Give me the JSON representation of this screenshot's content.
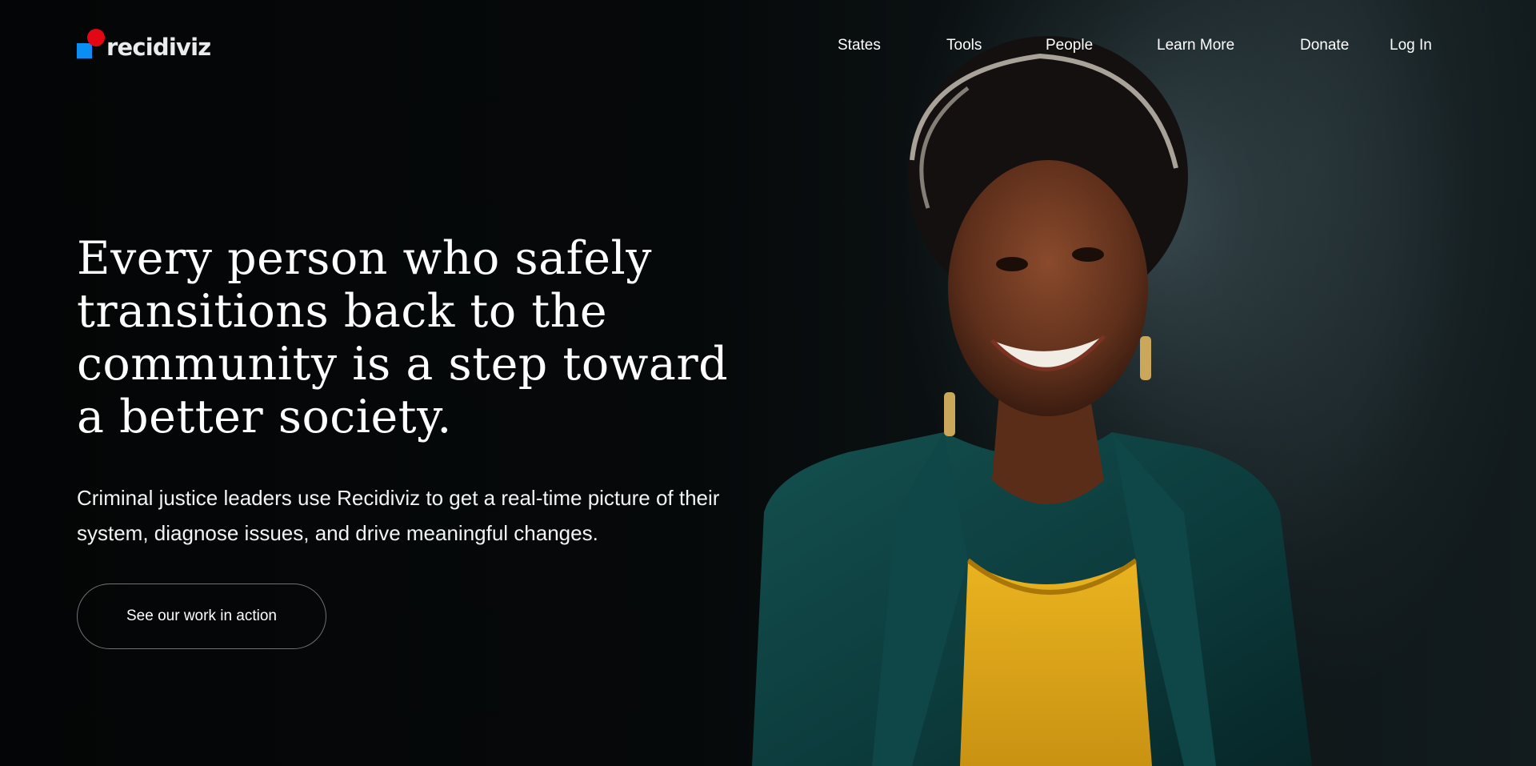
{
  "brand": {
    "name": "recidiviz",
    "logo_icon": "recidiviz-logo-mark",
    "colors": {
      "square": "#0b8ef3",
      "dot": "#e30613"
    }
  },
  "nav": {
    "items": [
      {
        "label": "States"
      },
      {
        "label": "Tools"
      },
      {
        "label": "People"
      },
      {
        "label": "Learn More"
      },
      {
        "label": "Donate"
      },
      {
        "label": "Log In"
      }
    ]
  },
  "hero": {
    "headline": "Every person who safely transitions back to the community is a step toward a better society.",
    "subtext": "Criminal justice leaders use Recidiviz to get a real-time picture of their system, diagnose issues, and drive meaningful changes.",
    "cta_label": "See our work in action",
    "image": "hero-photo-smiling-woman"
  },
  "colors": {
    "background": "#050708",
    "text": "#ffffff",
    "button_border": "#6d7275"
  }
}
